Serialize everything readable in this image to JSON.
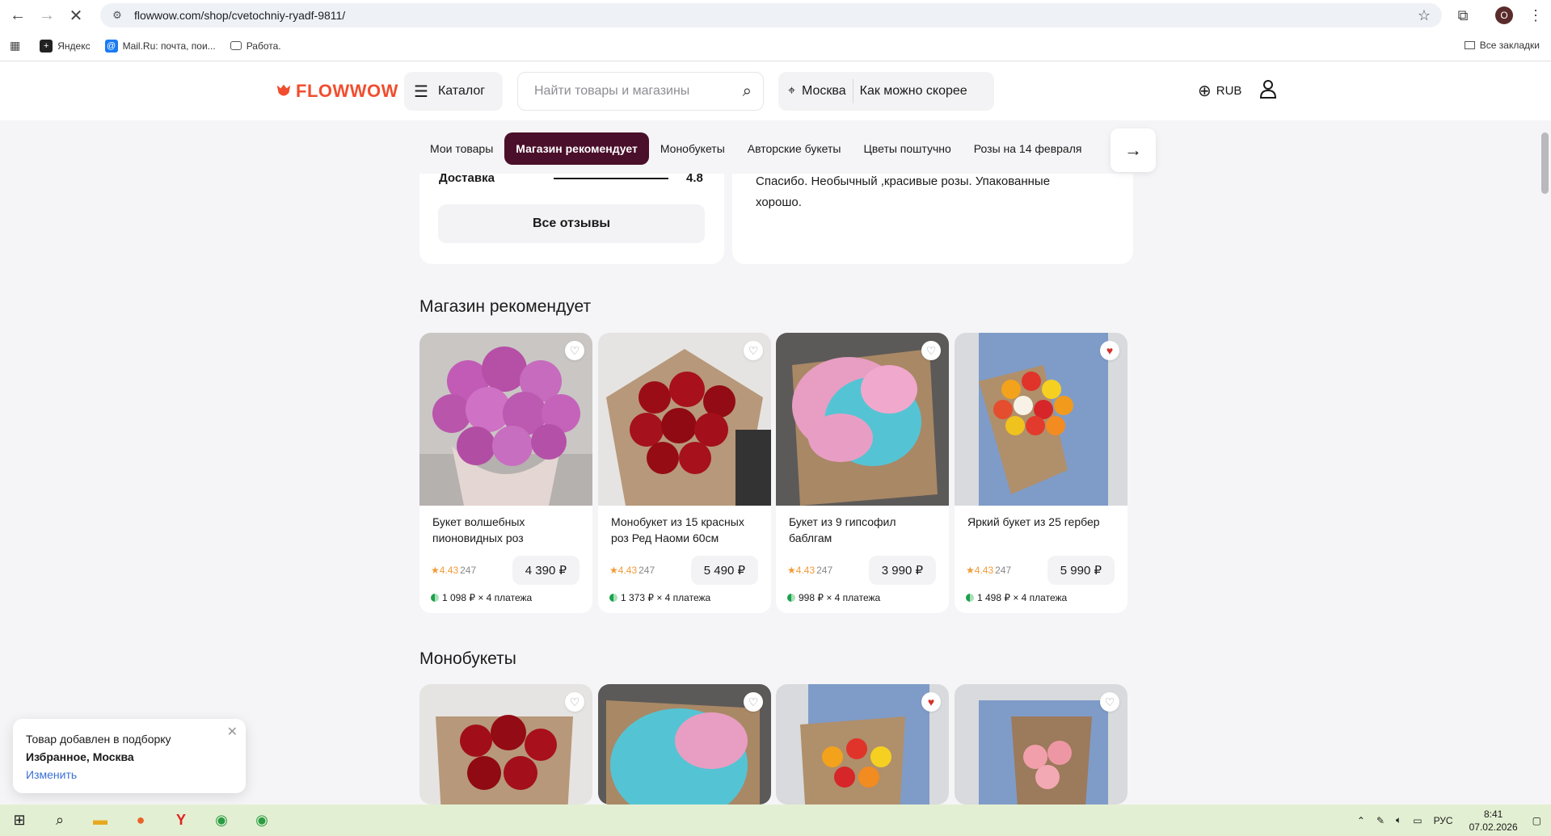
{
  "browser": {
    "url": "flowwow.com/shop/cvetochniy-ryadf-9811/",
    "profile_initial": "O",
    "bookmarks": [
      "Яндекс",
      "Mail.Ru: почта, пои...",
      "Работа."
    ],
    "all_bookmarks": "Все закладки"
  },
  "header": {
    "logo": "FLOWWOW",
    "catalog": "Каталог",
    "search_placeholder": "Найти товары и магазины",
    "city": "Москва",
    "delivery_time": "Как можно скорее",
    "currency": "RUB"
  },
  "tabs": [
    "Мои товары",
    "Магазин рекомендует",
    "Монобукеты",
    "Авторские букеты",
    "Цветы поштучно",
    "Розы на 14 февраля"
  ],
  "reviews": {
    "metric_label": "Доставка",
    "metric_value": "4.8",
    "all_reviews": "Все отзывы",
    "review_text": "Спасибо. Необычный ,красивые розы. Упакованные хорошо."
  },
  "sections": {
    "recommended_title": "Магазин рекомендует",
    "mono_title": "Монобукеты"
  },
  "products": [
    {
      "title": "Букет волшебных пионовидных роз",
      "rating": "4.43",
      "reviews": "247",
      "price": "4 390 ₽",
      "installment": "1 098 ₽ × 4 платежа",
      "fav": false
    },
    {
      "title": "Монобукет из 15 красных роз Ред Наоми 60см",
      "rating": "4.43",
      "reviews": "247",
      "price": "5 490 ₽",
      "installment": "1 373 ₽ × 4 платежа",
      "fav": false
    },
    {
      "title": "Букет из 9 гипсофил баблгам",
      "rating": "4.43",
      "reviews": "247",
      "price": "3 990 ₽",
      "installment": "998 ₽ × 4 платежа",
      "fav": false
    },
    {
      "title": "Яркий букет из 25 гербер",
      "rating": "4.43",
      "reviews": "247",
      "price": "5 990 ₽",
      "installment": "1 498 ₽ × 4 платежа",
      "fav": true
    }
  ],
  "toast": {
    "line1": "Товар добавлен в подборку",
    "line2": "Избранное, Москва",
    "action": "Изменить"
  },
  "taskbar": {
    "lang": "РУС",
    "time": "8:41",
    "date": "07.02.2026"
  }
}
